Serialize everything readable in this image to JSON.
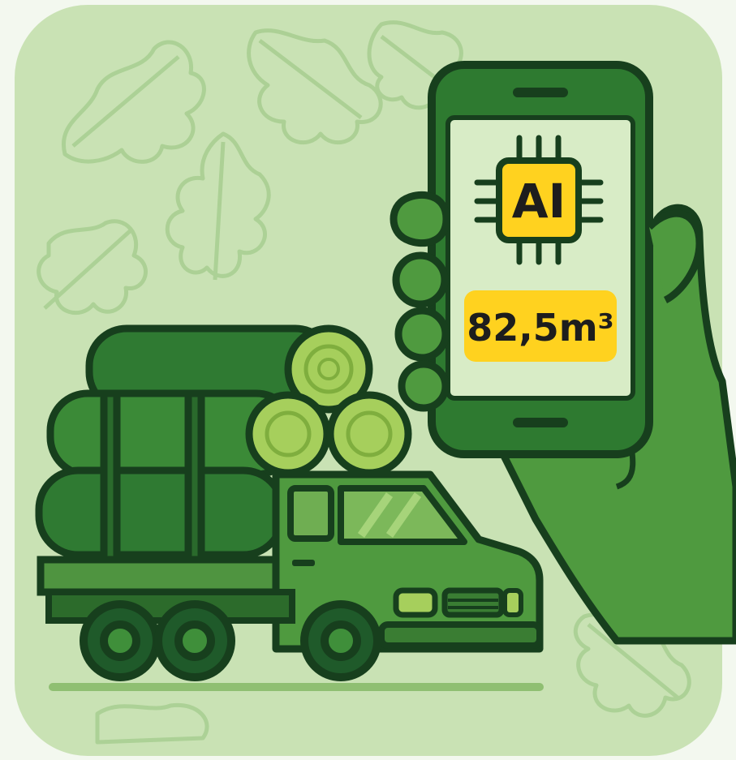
{
  "chip_label": "AI",
  "volume_readout": "82,5m³",
  "icons": {
    "chip": "ai-chip-icon",
    "truck": "log-truck-icon",
    "hand": "hand-icon",
    "phone": "smartphone-icon",
    "leaf": "oak-leaf-icon"
  },
  "colors": {
    "card_background": "#c9e2b4",
    "dark_green": "#1f5a2a",
    "mid_green": "#3f8f3a",
    "light_green": "#a6cf5c",
    "screen": "#d8ecc6",
    "accent_yellow": "#ffd21f"
  }
}
